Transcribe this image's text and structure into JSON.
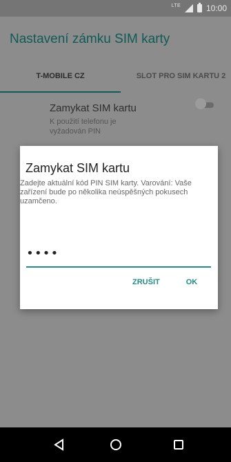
{
  "status_bar": {
    "network": "LTE",
    "time": "10:00"
  },
  "app_bar": {
    "title": "Nastavení zámku SIM karty"
  },
  "tabs": [
    {
      "label": "T-MOBILE CZ"
    },
    {
      "label": "SLOT PRO SIM KARTU 2"
    }
  ],
  "setting_row": {
    "title": "Zamykat SIM kartu",
    "subtitle": "K použití telefonu je vyžadován PIN"
  },
  "dialog": {
    "title": "Zamykat SIM kartu",
    "message": "Zadejte aktuální kód PIN SIM karty. Varování: Vaše zařízení bude po několika neúspěšných pokusech uzamčeno.",
    "pin_value": "••••",
    "cancel_label": "ZRUŠIT",
    "ok_label": "OK"
  },
  "nav_bar": {
    "back_icon": "back-triangle-icon",
    "home_icon": "home-circle-icon",
    "recents_icon": "recents-square-icon"
  },
  "colors": {
    "accent": "#1f8f86",
    "title_teal": "#0f5b57",
    "dim_background": "#8c8c8c"
  }
}
